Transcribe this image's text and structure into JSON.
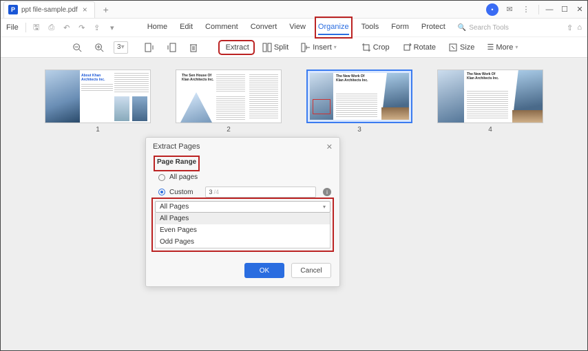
{
  "titlebar": {
    "tab_filename": "ppt file-sample.pdf",
    "avatar_initial": "•"
  },
  "menubar": {
    "file": "File",
    "tabs": [
      "Home",
      "Edit",
      "Comment",
      "Convert",
      "View",
      "Organize",
      "Tools",
      "Form",
      "Protect"
    ],
    "active_tab": "Organize",
    "search_placeholder": "Search Tools"
  },
  "toolbar": {
    "page_value": "3",
    "extract": "Extract",
    "split": "Split",
    "insert": "Insert",
    "crop": "Crop",
    "rotate": "Rotate",
    "size": "Size",
    "more": "More"
  },
  "thumbs": {
    "p1": {
      "num": "1",
      "title": "About Khan Architects Inc."
    },
    "p2": {
      "num": "2",
      "title": "The Sen House Of Klan Architects Inc."
    },
    "p3": {
      "num": "3",
      "title": "The New Work Of Klan Architects Inc."
    },
    "p4": {
      "num": "4",
      "title": "The New Work Of Klan Architects Inc."
    }
  },
  "dialog": {
    "title": "Extract Pages",
    "section": "Page Range",
    "all_pages": "All pages",
    "custom": "Custom",
    "range_value": "3",
    "range_total": "/4",
    "combo_value": "All Pages",
    "options": [
      "All Pages",
      "Even Pages",
      "Odd Pages"
    ],
    "ok": "OK",
    "cancel": "Cancel"
  }
}
